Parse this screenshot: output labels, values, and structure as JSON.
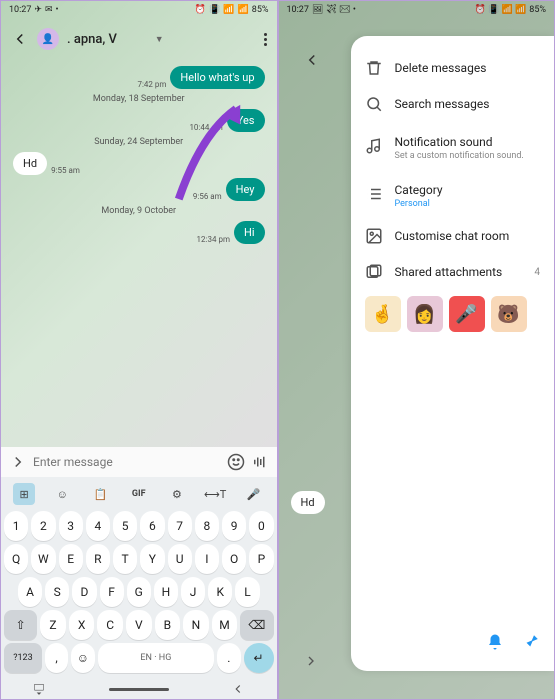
{
  "status": {
    "time": "10:27",
    "battery": "85%",
    "time_right": "10:27"
  },
  "chat": {
    "contact_name": ". apna, V",
    "placeholder": "Enter message",
    "messages": [
      {
        "dir": "out",
        "text": "Hello what's up",
        "time": "7:42 pm"
      }
    ],
    "dates": [
      "Monday, 18 September",
      "Sunday, 24 September",
      "Monday, 9 October"
    ],
    "msg_yes": {
      "text": "Yes",
      "time": "10:44 am"
    },
    "msg_hd": {
      "text": "Hd",
      "time": "9:55 am"
    },
    "msg_hey": {
      "text": "Hey",
      "time": "9:56 am"
    },
    "msg_hi": {
      "text": "Hi",
      "time": "12:34 pm"
    }
  },
  "keyboard": {
    "lang": "EN · HG",
    "num_key": "?123",
    "gif": "GIF"
  },
  "menu": {
    "delete": "Delete messages",
    "search": "Search messages",
    "notif": "Notification sound",
    "notif_sub": "Set a custom notification sound.",
    "category": "Category",
    "category_sub": "Personal",
    "customise": "Customise chat room",
    "attachments": "Shared attachments",
    "attachments_count": "4"
  },
  "hint_bubble": "Hd"
}
